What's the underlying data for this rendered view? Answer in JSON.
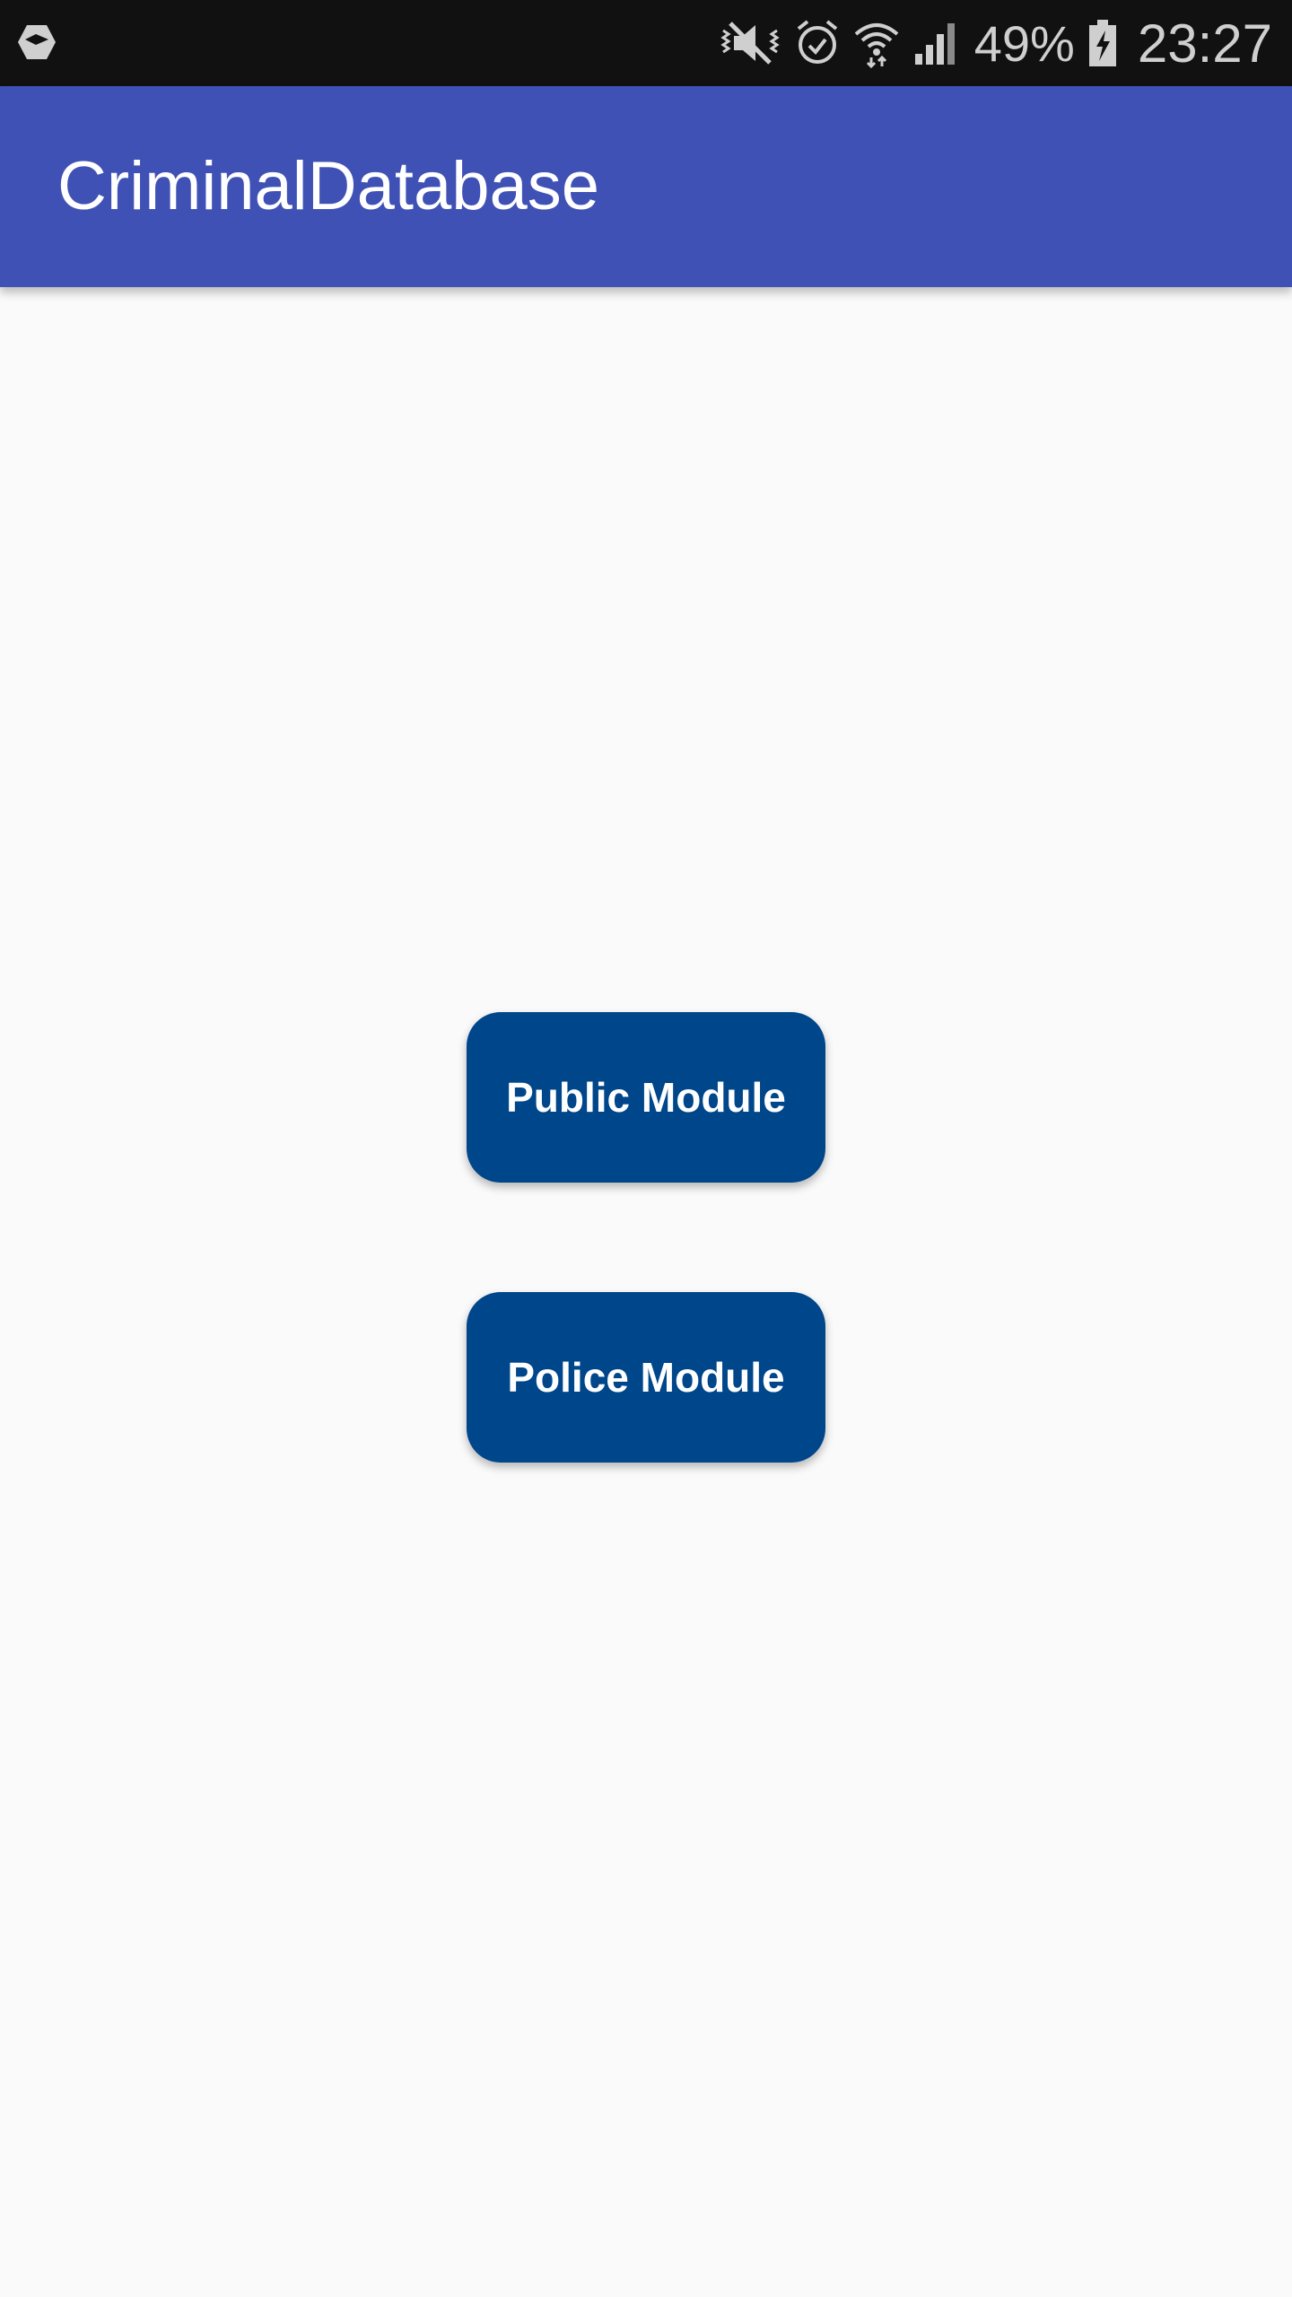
{
  "status_bar": {
    "battery_percent": "49%",
    "time": "23:27",
    "icons": [
      "app-notification-icon",
      "vibrate-mute-icon",
      "alarm-icon",
      "wifi-icon",
      "signal-icon",
      "battery-charging-icon"
    ]
  },
  "app_bar": {
    "title": "CriminalDatabase",
    "color": "#3f51b5"
  },
  "main": {
    "buttons": [
      {
        "label": "Public Module",
        "color": "#00468b"
      },
      {
        "label": "Police Module",
        "color": "#00468b"
      }
    ]
  }
}
